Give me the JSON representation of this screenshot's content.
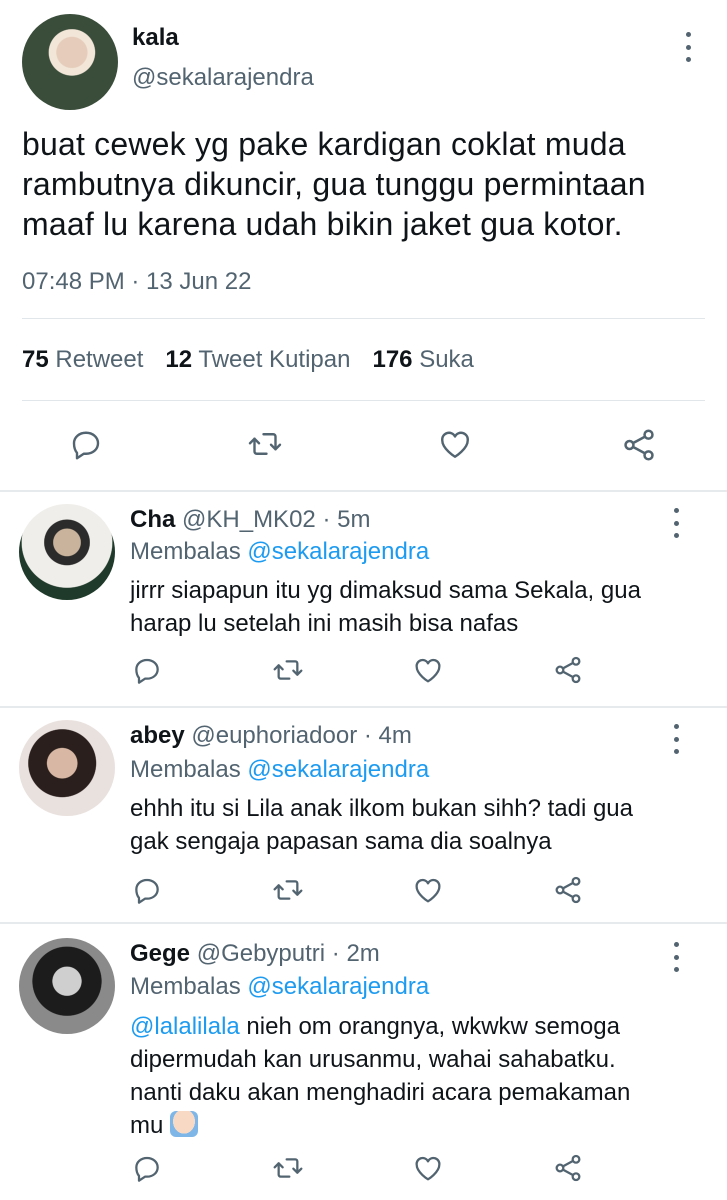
{
  "main_tweet": {
    "display_name": "kala",
    "handle": "@sekalarajendra",
    "text_lines": [
      "buat cewek yg pake kardigan coklat muda",
      "rambutnya dikuncir, gua tunggu permintaan",
      "maaf lu karena udah bikin jaket gua kotor."
    ],
    "timestamp": "07:48 PM · 13 Jun 22",
    "stats": {
      "retweets_count": "75",
      "retweets_label": "Retweet",
      "quotes_count": "12",
      "quotes_label": "Tweet Kutipan",
      "likes_count": "176",
      "likes_label": "Suka"
    }
  },
  "replies": [
    {
      "name": "Cha",
      "handle": "@KH_MK02",
      "time": "· 5m",
      "replying_label": "Membalas",
      "replying_to": "@sekalarajendra",
      "text_lines": [
        "jirrr siapapun itu yg dimaksud sama Sekala, gua",
        "harap lu setelah ini masih bisa nafas"
      ]
    },
    {
      "name": "abey",
      "handle": "@euphoriadoor",
      "time": "· 4m",
      "replying_label": "Membalas",
      "replying_to": "@sekalarajendra",
      "text_lines": [
        "ehhh itu si Lila anak ilkom bukan sihh? tadi gua",
        "gak sengaja papasan sama dia soalnya"
      ]
    },
    {
      "name": "Gege",
      "handle": "@Gebyputri",
      "time": "· 2m",
      "replying_label": "Membalas",
      "replying_to": "@sekalarajendra",
      "mention": "@lalalilala",
      "text_lines": [
        " nieh om orangnya, wkwkw semoga",
        "dipermudah kan urusanmu, wahai sahabatku.",
        "nanti daku akan menghadiri acara pemakaman",
        "mu"
      ]
    }
  ],
  "icons": {
    "reply": "reply-icon",
    "retweet": "retweet-icon",
    "like": "heart-icon",
    "share": "share-icon",
    "more": "more-vertical-icon"
  },
  "colors": {
    "accent": "#1d9bf0",
    "muted": "#536471",
    "text": "#0f1419"
  }
}
